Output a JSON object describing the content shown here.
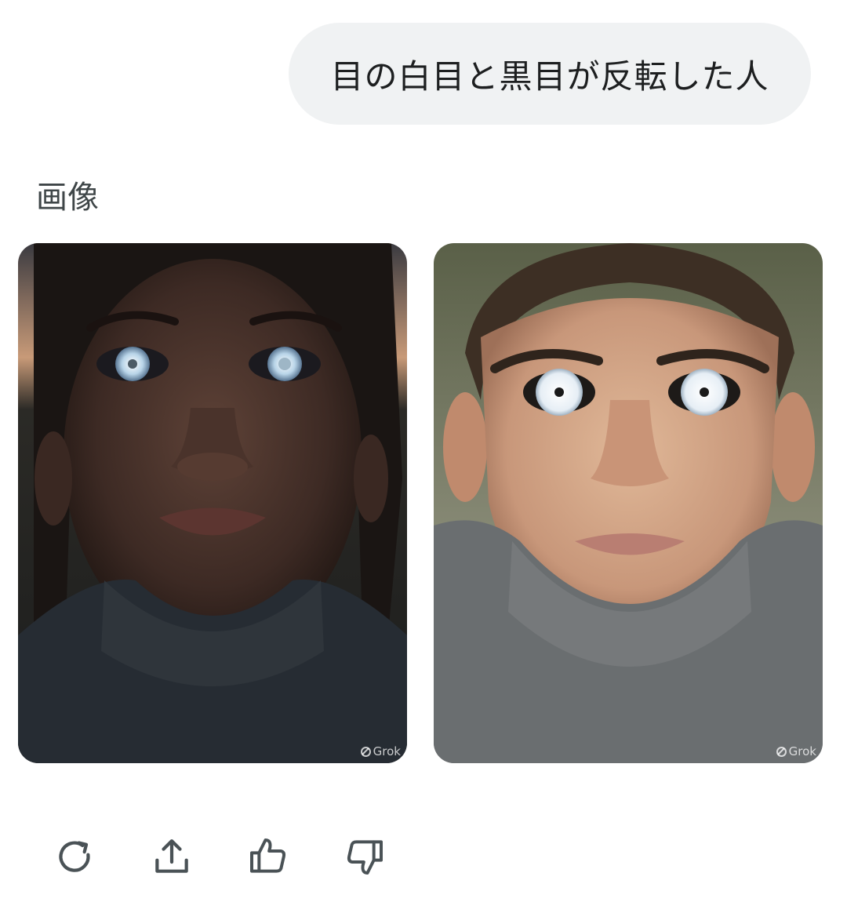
{
  "conversation": {
    "user_message": "目の白目と黒目が反転した人"
  },
  "response": {
    "section_label": "画像",
    "images": [
      {
        "watermark": "Grok",
        "description_icon": "portrait-woman-image"
      },
      {
        "watermark": "Grok",
        "description_icon": "portrait-man-image"
      }
    ]
  },
  "actions": {
    "icons": [
      "regenerate-icon",
      "share-icon",
      "thumbs-up-icon",
      "thumbs-down-icon"
    ]
  },
  "colors": {
    "bubble_bg": "#f0f2f3",
    "text": "#1d1f20",
    "icon": "#4a5256"
  }
}
